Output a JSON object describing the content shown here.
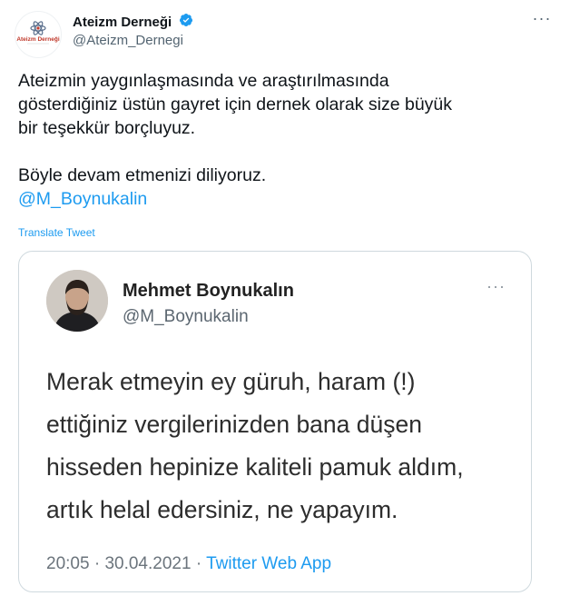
{
  "tweet": {
    "display_name": "Ateizm Derneği",
    "handle": "@Ateizm_Dernegi",
    "avatar_logo_text": "Ateizm Derneği",
    "verified_icon": "verified-badge-icon",
    "more_label": "···",
    "text_lines": [
      "Ateizmin yaygınlaşmasında ve araştırılmasında",
      "gösterdiğiniz üstün gayret için dernek olarak size büyük",
      "bir teşekkür borçluyuz."
    ],
    "text_line_2": "Böyle devam etmenizi diliyoruz.",
    "mention": "@M_Boynukalin",
    "translate_label": "Translate Tweet"
  },
  "embedded": {
    "display_name": "Mehmet Boynukalın",
    "handle": "@M_Boynukalin",
    "more_label": "···",
    "text_lines": [
      "Merak etmeyin ey güruh, haram (!)",
      "ettiğiniz vergilerinizden bana düşen",
      "hisseden hepinize kaliteli pamuk aldım,",
      "artık helal edersiniz, ne yapayım."
    ],
    "time": "20:05",
    "date": "30.04.2021",
    "separator": "·",
    "app": "Twitter Web App"
  },
  "colors": {
    "link": "#1d9bf0",
    "text": "#0f1419",
    "muted": "#536471",
    "border": "#cfd9de"
  }
}
